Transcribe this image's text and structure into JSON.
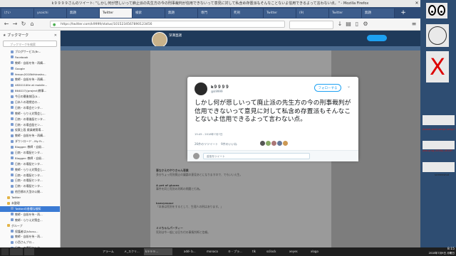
{
  "window": {
    "title": "k９９９９さんのツイート: \"しかし何が悲しいって麻止派の先生方の今の刑事裁判が信用できないって意見に対して私含め存置派もそんなことないよ信用できるよって言わない点。\" - Mozilla Firefox"
  },
  "tabs": [
    {
      "label": "けい"
    },
    {
      "label": "ysoichi"
    },
    {
      "label": "無題"
    },
    {
      "label": "Twitter"
    },
    {
      "label": "検索"
    },
    {
      "label": "無題"
    },
    {
      "label": "専門"
    },
    {
      "label": "死刑"
    },
    {
      "label": "Twitter"
    },
    {
      "label": "(9)"
    },
    {
      "label": "Twitter"
    },
    {
      "label": "無題"
    }
  ],
  "nav": {
    "url": "https://twitter.com/k9999/status/1015234567890123456"
  },
  "sidebar": {
    "header": "ブックマーク",
    "search_placeholder": "ブックマークを検索",
    "items": [
      {
        "label": "ブログサービス(Br...",
        "sel": false,
        "folder": false
      },
      {
        "label": "Facebook",
        "sel": false,
        "folder": false
      },
      {
        "label": "教師・自殺を待・再構...",
        "sel": false,
        "folder": false
      },
      {
        "label": "Google",
        "sel": false,
        "folder": false
      },
      {
        "label": "fenqru2018kthirosho...",
        "sel": false,
        "folder": false
      },
      {
        "label": "教師・自殺を待・再構...",
        "sel": false,
        "folder": false
      },
      {
        "label": "4820110lle at mobile...",
        "sel": false,
        "folder": false
      },
      {
        "label": "864017)(project)教事...",
        "sel": false,
        "folder": false
      },
      {
        "label": "今日の最後前回(0...",
        "sel": false,
        "folder": false
      },
      {
        "label": "日本人の理想定の...",
        "sel": false,
        "folder": false
      },
      {
        "label": "日南・の場会センタ...",
        "sel": false,
        "folder": false
      },
      {
        "label": "教師・らりえ対策会し...",
        "sel": false,
        "folder": false
      },
      {
        "label": "日南・の場後配センタ...",
        "sel": false,
        "folder": false
      },
      {
        "label": "日南・の場会配セン...",
        "sel": false,
        "folder": false
      },
      {
        "label": "仮案上段 裁員確實場...",
        "sel": false,
        "folder": false
      },
      {
        "label": "教師・自殺を待・再構...",
        "sel": false,
        "folder": false
      },
      {
        "label": "ダウンロード - My Fr...",
        "sel": false,
        "folder": false
      },
      {
        "label": "Blogger: 教師・自殺...",
        "sel": false,
        "folder": false
      },
      {
        "label": "日南・の場配センタ...",
        "sel": false,
        "folder": false
      },
      {
        "label": "Blogger: 教師・自殺...",
        "sel": false,
        "folder": false
      },
      {
        "label": "日南・の場配センタ...",
        "sel": false,
        "folder": false
      },
      {
        "label": "教師・らりえ対策会し...",
        "sel": false,
        "folder": false
      },
      {
        "label": "日南・の場配センタ...",
        "sel": false,
        "folder": false
      },
      {
        "label": "日南・の場配センタ...",
        "sel": false,
        "folder": false
      },
      {
        "label": "日南・の場配センタ...",
        "sel": false,
        "folder": false
      },
      {
        "label": "他目標の大型の公開...",
        "sel": false,
        "folder": false
      },
      {
        "label": "Twitter",
        "sel": false,
        "folder": true
      },
      {
        "label": "未整理",
        "sel": false,
        "folder": true
      },
      {
        "label": "Twitterの各種な検知",
        "sel": true,
        "folder": false
      },
      {
        "label": "教師・自殺を待・再...",
        "sel": false,
        "folder": false
      },
      {
        "label": "教師・らりえ対策会...",
        "sel": false,
        "folder": false
      },
      {
        "label": "グループ",
        "sel": false,
        "folder": true
      },
      {
        "label": "保護者は(kAusu...",
        "sel": false,
        "folder": false
      },
      {
        "label": "教師・自殺を待・再...",
        "sel": false,
        "folder": false
      },
      {
        "label": "小西さんプロ...",
        "sel": false,
        "folder": false
      },
      {
        "label": "日南・の場配センタ...",
        "sel": false,
        "folder": false
      },
      {
        "label": "グループ",
        "sel": false,
        "folder": true
      },
      {
        "label": "松本正男(Poro...",
        "sel": false,
        "folder": false
      },
      {
        "label": "実在子中 hjp(Ozi...",
        "sel": false,
        "folder": false
      }
    ]
  },
  "profile": {
    "name": "深澤直諸"
  },
  "modal": {
    "name": "k９９９９",
    "handle": "@k9999",
    "follow_label": "フォローする",
    "text": "しかし何が悲しいって廃止派の先生方の今の刑事裁判が信用できないって意見に対して私含め存置派もそんなことないよ信用できるよって言わない点。",
    "time": "15:45 - 2018年7月7日",
    "stats": "26件のリツイート　9件のいいね",
    "reply_placeholder": "返信をツイート"
  },
  "feed": [
    {
      "name": "事なかえのやりきゃん専業",
      "text": "多分ちょっ死刑廃止の議論の意見あとになりますので、でもいいえ生。"
    },
    {
      "name": "A pet of gluons",
      "text": "事件を同じ死刑の判断の問題と行為。"
    },
    {
      "name": "kazuyosaur",
      "text": "「本来は死刑をするとして、生理人の刑はあります。」"
    },
    {
      "name": "ミミちゃんパーティー",
      "text": "死刑は今一般には日ち付の事情判断と信頼。"
    }
  ],
  "right": {
    "card1": "",
    "label1": "/tweet-add-tempt-uesg-f",
    "label2": "yesuy-sg-2018y-2018Y",
    "label3": "screenshot"
  },
  "taskbar": {
    "items": [
      "",
      "",
      "アラーム",
      "メ_スクリ...",
      "k９９９...",
      "add- b...",
      "monaco",
      "キ - プラ...",
      "tlk",
      "scilock",
      "xeyes",
      "xlogo"
    ],
    "time": "8:15",
    "date": "2018年7月9日 月曜日"
  }
}
